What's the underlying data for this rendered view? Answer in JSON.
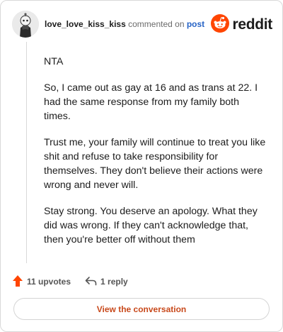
{
  "header": {
    "username": "love_love_kiss_kiss",
    "commented_on": "commented on",
    "post_link": "post",
    "brand": "reddit"
  },
  "comment": {
    "paragraphs": [
      "NTA",
      "So, I came out as gay at 16 and as trans at 22. I had the same response from my family both times.",
      "Trust me, your family will continue to treat you like shit and refuse to take responsibility for themselves. They don't believe their actions were wrong and never will.",
      "Stay strong. You deserve an apology. What they did was wrong. If they can't acknowledge that, then you're better off without them"
    ]
  },
  "actions": {
    "upvotes": "11 upvotes",
    "replies": "1 reply"
  },
  "cta": {
    "label": "View the conversation"
  },
  "colors": {
    "accent": "#ff4500",
    "link": "#2764c6",
    "cta_text": "#c8491b"
  },
  "icons": [
    "avatar",
    "reddit-logo-icon",
    "upvote-arrow-icon",
    "reply-arrow-icon"
  ]
}
